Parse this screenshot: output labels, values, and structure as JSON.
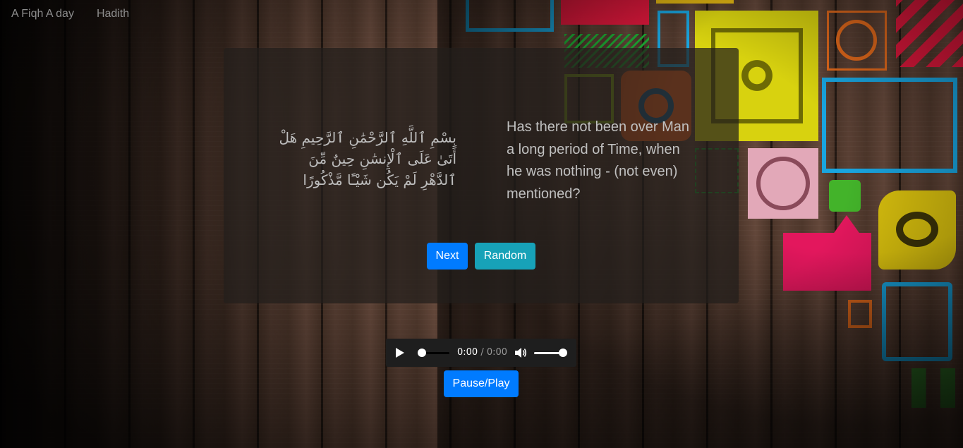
{
  "nav": {
    "links": [
      {
        "label": "A Fiqh A day"
      },
      {
        "label": "Hadith"
      }
    ]
  },
  "verse": {
    "arabic": "بِسْمِ ٱللَّهِ ٱلرَّحْمَٰنِ ٱلرَّحِيمِ هَلْ أَتَىٰ عَلَى ٱلْإِنسَٰنِ حِينٌ مِّنَ ٱلدَّهْرِ لَمْ يَكُن شَيْـًٔا مَّذْكُورًا",
    "translation": "Has there not been over Man a long period of Time, when he was nothing - (not even) mentioned?"
  },
  "buttons": {
    "next": "Next",
    "random": "Random",
    "pause_play": "Pause/Play"
  },
  "audio": {
    "current_time": "0:00",
    "separator": " / ",
    "duration": "0:00",
    "progress_fraction": 0,
    "volume_fraction": 1,
    "play_icon": "play-icon",
    "volume_icon": "volume-icon"
  },
  "colors": {
    "primary": "#007bff",
    "info": "#17a2b8"
  }
}
